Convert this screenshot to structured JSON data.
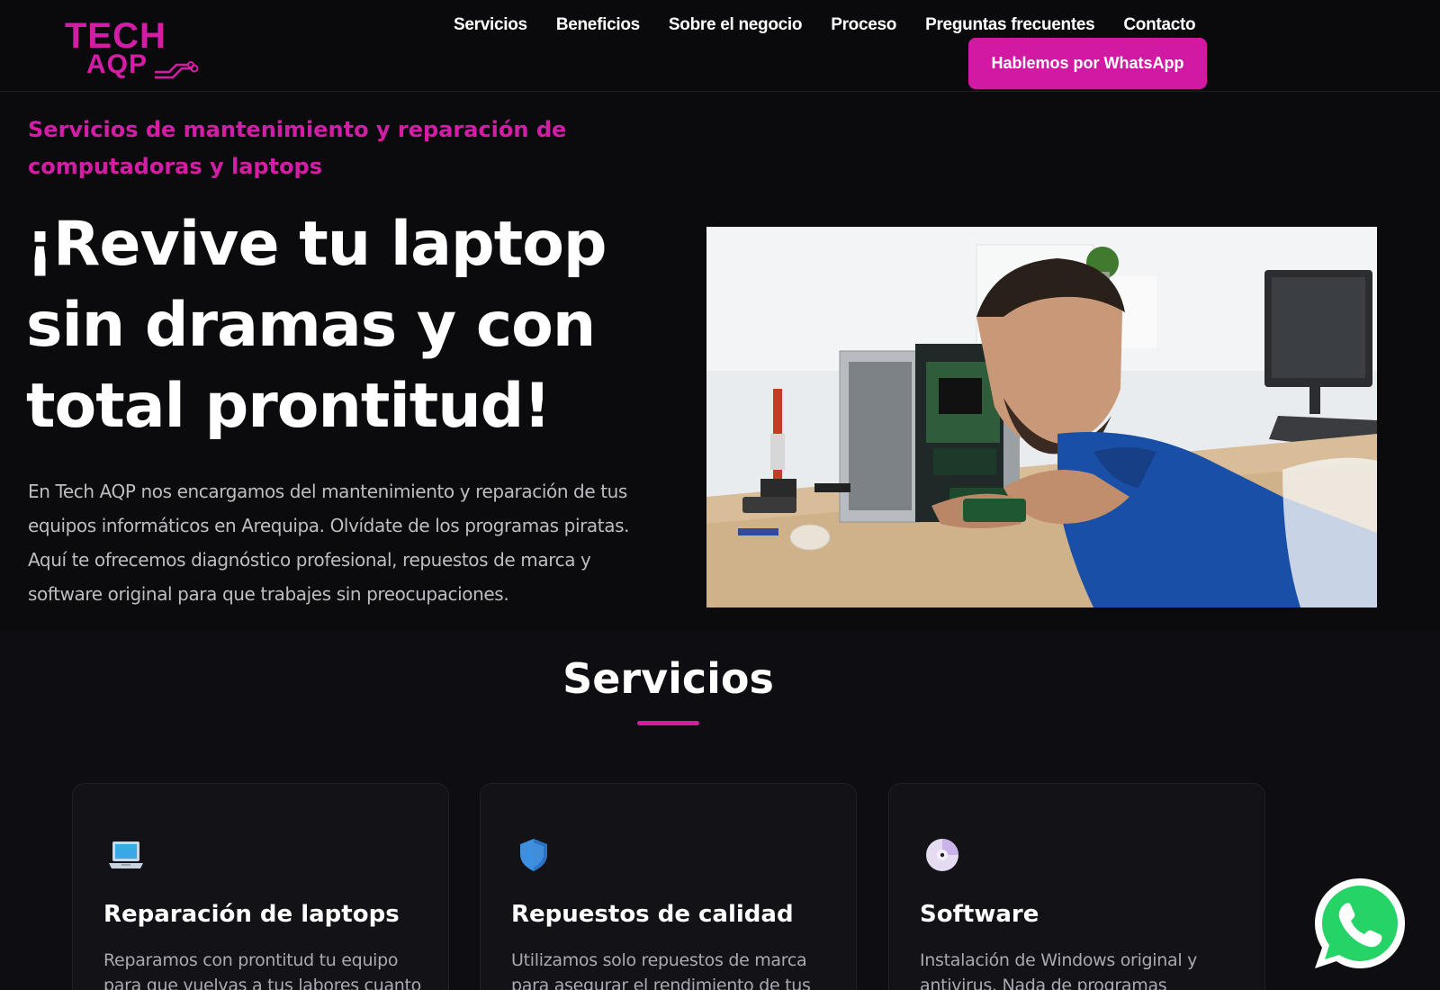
{
  "header": {
    "logo_top": "TECH",
    "logo_bottom": "AQP",
    "nav": [
      {
        "label": "Servicios"
      },
      {
        "label": "Beneficios"
      },
      {
        "label": "Sobre el negocio"
      },
      {
        "label": "Proceso"
      },
      {
        "label": "Preguntas frecuentes"
      },
      {
        "label": "Contacto"
      }
    ],
    "cta_label": "Hablemos por WhatsApp"
  },
  "hero": {
    "eyebrow": "Servicios de mantenimiento y reparación de computadoras y laptops",
    "title": "¡Revive tu laptop sin dramas y con total prontitud!",
    "body": "En Tech AQP nos encargamos del mantenimiento y reparación de tus equipos informáticos en Arequipa. Olvídate de los programas piratas. Aquí te ofrecemos diagnóstico profesional, repuestos de marca y software original para que trabajes sin preocupaciones."
  },
  "services": {
    "title": "Servicios",
    "cards": [
      {
        "icon": "laptop-icon",
        "title": "Reparación de laptops",
        "desc": "Reparamos con prontitud tu equipo para que vuelvas a tus labores cuanto"
      },
      {
        "icon": "shield-icon",
        "title": "Repuestos de calidad",
        "desc": "Utilizamos solo repuestos de marca para asegurar el rendimiento de tus"
      },
      {
        "icon": "disc-icon",
        "title": "Software",
        "desc": "Instalación de Windows original y antivirus. Nada de programas"
      }
    ]
  },
  "colors": {
    "accent": "#d41da6",
    "background": "#0b0b0d",
    "card": "#121217",
    "whatsapp": "#25d366"
  }
}
